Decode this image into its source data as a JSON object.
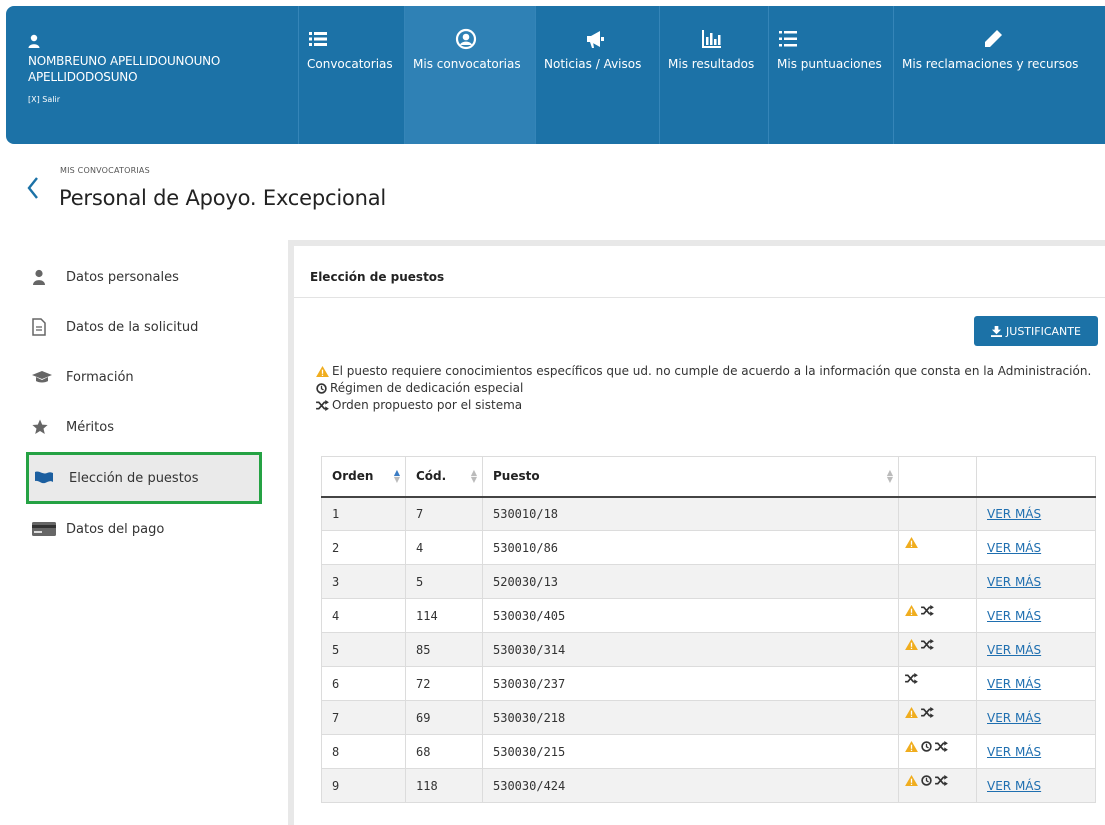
{
  "user": {
    "name": "NOMBREUNO APELLIDOUNOUNO APELLIDODOSUNO",
    "logout": "[X] Salir"
  },
  "nav": [
    {
      "label": "Convocatorias",
      "icon": "list-icon"
    },
    {
      "label": "Mis convocatorias",
      "icon": "user-circle-icon",
      "active": true
    },
    {
      "label": "Noticias / Avisos",
      "icon": "megaphone-icon"
    },
    {
      "label": "Mis resultados",
      "icon": "bar-chart-icon"
    },
    {
      "label": "Mis puntuaciones",
      "icon": "ordered-list-icon"
    },
    {
      "label": "Mis reclamaciones y recursos",
      "icon": "pencil-icon"
    }
  ],
  "page": {
    "breadcrumb": "MIS CONVOCATORIAS",
    "title": "Personal de Apoyo. Excepcional"
  },
  "sidebar": [
    {
      "label": "Datos personales",
      "icon": "person-icon"
    },
    {
      "label": "Datos de la solicitud",
      "icon": "document-icon"
    },
    {
      "label": "Formación",
      "icon": "graduation-cap-icon"
    },
    {
      "label": "Méritos",
      "icon": "star-icon"
    },
    {
      "label": "Elección de puestos",
      "icon": "flag-icon",
      "active": true
    },
    {
      "label": "Datos del pago",
      "icon": "credit-card-icon"
    }
  ],
  "panel": {
    "title": "Elección de puestos",
    "button": "JUSTIFICANTE",
    "legend": {
      "warning": "El puesto requiere conocimientos específicos que ud. no cumple de acuerdo a la información que consta en la Administración.",
      "clock": "Régimen de dedicación especial",
      "shuffle": "Orden propuesto por el sistema"
    }
  },
  "table": {
    "headers": {
      "orden": "Orden",
      "cod": "Cód.",
      "puesto": "Puesto"
    },
    "link_label": "VER MÁS",
    "rows": [
      {
        "orden": "1",
        "cod": "7",
        "puesto": "530010/18",
        "warning": false,
        "clock": false,
        "shuffle": false
      },
      {
        "orden": "2",
        "cod": "4",
        "puesto": "530010/86",
        "warning": true,
        "clock": false,
        "shuffle": false
      },
      {
        "orden": "3",
        "cod": "5",
        "puesto": "520030/13",
        "warning": false,
        "clock": false,
        "shuffle": false
      },
      {
        "orden": "4",
        "cod": "114",
        "puesto": "530030/405",
        "warning": true,
        "clock": false,
        "shuffle": true
      },
      {
        "orden": "5",
        "cod": "85",
        "puesto": "530030/314",
        "warning": true,
        "clock": false,
        "shuffle": true
      },
      {
        "orden": "6",
        "cod": "72",
        "puesto": "530030/237",
        "warning": false,
        "clock": false,
        "shuffle": true
      },
      {
        "orden": "7",
        "cod": "69",
        "puesto": "530030/218",
        "warning": true,
        "clock": false,
        "shuffle": true
      },
      {
        "orden": "8",
        "cod": "68",
        "puesto": "530030/215",
        "warning": true,
        "clock": true,
        "shuffle": true
      },
      {
        "orden": "9",
        "cod": "118",
        "puesto": "530030/424",
        "warning": true,
        "clock": true,
        "shuffle": true
      }
    ]
  },
  "colors": {
    "primary": "#1c72a7",
    "highlight": "#25a244",
    "warning": "#f0ad1e",
    "link": "#1f6fb0"
  }
}
